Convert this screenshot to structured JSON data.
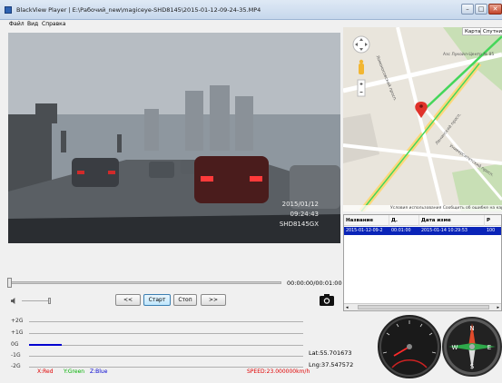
{
  "window": {
    "title": "BlackView Player | E:\\Рабочий_new\\magiceye-SHD8145\\2015-01-12-09-24-35.MP4",
    "min": "–",
    "max": "□",
    "close": "✕"
  },
  "menu": [
    "Файл",
    "Вид",
    "Справка"
  ],
  "video": {
    "date": "2015/01/12",
    "time": "09:24:43",
    "device": "SHD8145GX"
  },
  "playback": {
    "time": "00:00:00/00:01:00",
    "progress": 0.0,
    "volume": 0.9,
    "buttons": {
      "prev": "<<",
      "start": "Старт",
      "stop": "Стоп",
      "next": ">>"
    }
  },
  "map": {
    "tabs": [
      "Карта",
      "Спутник"
    ],
    "labels": [
      "Азс Лукойл-Центр № 85",
      "Университетский просп.",
      "Ленинский просп.",
      "Ломоносовский просп."
    ],
    "footer": "Условия использования   Сообщить об ошибке на карте",
    "colors": {
      "route": "#44d65a",
      "marker": "#e0322a",
      "road": "#ffffff",
      "major_road": "#fdd87a",
      "park": "#c8dfb5"
    }
  },
  "table": {
    "headers": [
      "Название",
      "Д.",
      "Дата изме",
      "Р"
    ],
    "rows": [
      [
        "2015-01-12-09-2",
        "00:01:00",
        "2015-01-14 10:29:53",
        "100"
      ]
    ]
  },
  "graph": {
    "axis_labels": [
      "+2G",
      "+1G",
      "0G",
      "-1G",
      "-2G"
    ],
    "legend": {
      "x": "X:Red",
      "y": "Y:Green",
      "z": "Z:Blue"
    },
    "speed": "SPEED:23.000000km/h",
    "lat": "Lat:55.701673",
    "lng": "Lng:37.547572",
    "colors": {
      "x": "#e00000",
      "y": "#00b000",
      "z": "#0000d0"
    }
  },
  "gauges": {
    "speed_kmh": 23,
    "heading": "NE"
  }
}
